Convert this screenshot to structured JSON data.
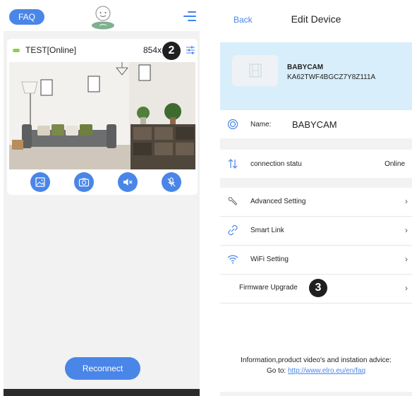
{
  "left": {
    "header": {
      "faq_label": "FAQ",
      "logo_icon": "baby-face-logo-icon",
      "menu_icon": "menu-icon"
    },
    "camera": {
      "status_color": "#8ad04a",
      "name_label": "TEST[Online]",
      "resolution_label": "854x",
      "badge": "2",
      "controls": [
        {
          "name": "snapshot-gallery-button",
          "icon": "picture-icon"
        },
        {
          "name": "camera-capture-button",
          "icon": "camera-icon"
        },
        {
          "name": "speaker-mute-button",
          "icon": "speaker-mute-icon"
        },
        {
          "name": "microphone-mute-button",
          "icon": "microphone-mute-icon"
        }
      ]
    },
    "reconnect_label": "Reconnect"
  },
  "right": {
    "header": {
      "back_label": "Back",
      "title": "Edit Device"
    },
    "device": {
      "name": "BABYCAM",
      "id": "KA62TWF4BGCZ7Y8Z111A"
    },
    "name_row": {
      "label": "Name:",
      "value": "BABYCAM"
    },
    "connection_row": {
      "label": "connection statu",
      "value": "Online"
    },
    "menu": [
      {
        "label": "Advanced Setting",
        "icon": "wrench-icon"
      },
      {
        "label": "Smart Link",
        "icon": "link-icon"
      },
      {
        "label": "WiFi Setting",
        "icon": "wifi-icon"
      },
      {
        "label": "Firmware Upgrade",
        "icon": ""
      }
    ],
    "firmware_badge": "3",
    "info_text": "Information,product video's and instation advice:",
    "info_prefix": "Go to: ",
    "info_link": "http://www.elro.eu/en/faq"
  },
  "colors": {
    "accent": "#4a86e8",
    "banner": "#d8eefa",
    "online": "#8ad04a"
  }
}
